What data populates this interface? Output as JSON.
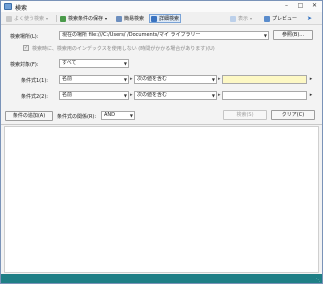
{
  "window": {
    "title": "検索"
  },
  "toolbar": {
    "recent_searches": "よく使う検索",
    "save_conditions": "検索条件の保存",
    "simple_search": "簡易検索",
    "advanced_search": "詳細検索",
    "view": "表示",
    "preview": "プレビュー"
  },
  "form": {
    "location_label": "検索場所(L):",
    "location_value": "現在の場所 file:///C:/Users/            /Documents/マイ ライブラリー",
    "browse_button": "参照(B)...",
    "no_index_checkbox": "検索時に、検索用のインデックスを使用しない (時間がかかる場合があります)(U)",
    "target_label": "検索対象(F):",
    "target_value": "すべて",
    "condition1_label": "条件式1(1):",
    "condition1_field": "名前",
    "condition1_operator": "次の値を含む",
    "condition1_value": "",
    "condition2_label": "条件式2(2):",
    "condition2_field": "名前",
    "condition2_operator": "次の値を含む",
    "condition2_value": "",
    "add_condition_button": "条件の追加(A)",
    "combine_label": "条件式の関係(R):",
    "combine_value": "AND",
    "search_button": "検索(S)",
    "clear_button": "クリア(C)"
  },
  "colors": {
    "status_bar": "#1f7f86",
    "highlight_field": "#fdf8c4",
    "active_tab": "#dde9f7"
  }
}
